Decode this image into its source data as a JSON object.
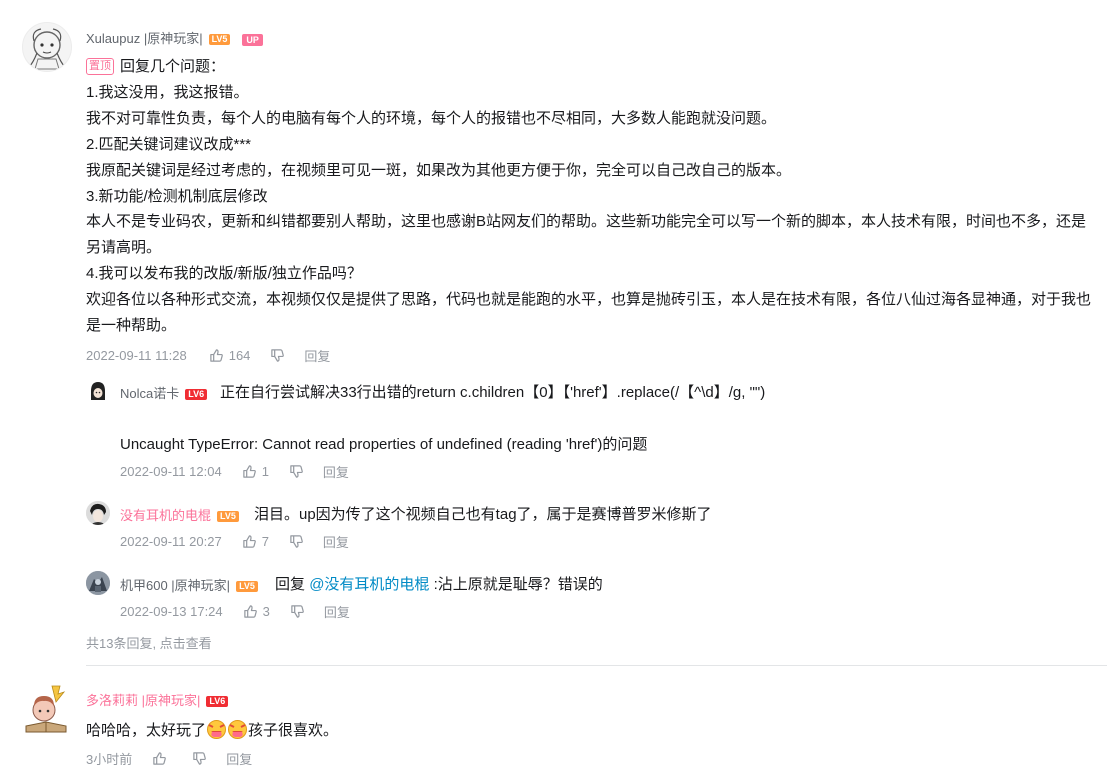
{
  "comment1": {
    "username": "Xulaupuz |原神玩家|",
    "level": "LV5",
    "up_badge": "UP",
    "pinned_label": "置顶",
    "lines": [
      "回复几个问题：",
      "1.我这没用，我这报错。",
      "我不对可靠性负责，每个人的电脑有每个人的环境，每个人的报错也不尽相同，大多数人能跑就没问题。",
      "2.匹配关键词建议改成***",
      "我原配关键词是经过考虑的，在视频里可见一斑，如果改为其他更方便于你，完全可以自己改自己的版本。",
      "3.新功能/检测机制底层修改",
      "本人不是专业码农，更新和纠错都要别人帮助，这里也感谢B站网友们的帮助。这些新功能完全可以写一个新的脚本，本人技术有限，时间也不多，还是另请高明。",
      "4.我可以发布我的改版/新版/独立作品吗？",
      "欢迎各位以各种形式交流，本视频仅仅是提供了思路，代码也就是能跑的水平，也算是抛砖引玉，本人是在技术有限，各位八仙过海各显神通，对于我也是一种帮助。"
    ],
    "time": "2022-09-11 11:28",
    "likes": "164",
    "reply_label": "回复"
  },
  "replies": [
    {
      "username": "Nolca诺卡",
      "level": "LV6",
      "line1": "正在自行尝试解决33行出错的return c.children【0】【'href'】.replace(/【^\\d】/g, \"\")",
      "line2": "Uncaught TypeError: Cannot read properties of undefined (reading 'href')的问题",
      "time": "2022-09-11 12:04",
      "likes": "1",
      "reply_label": "回复"
    },
    {
      "username": "没有耳机的电棍",
      "level": "LV5",
      "text": "泪目。up因为传了这个视频自己也有tag了，属于是赛博普罗米修斯了",
      "time": "2022-09-11 20:27",
      "likes": "7",
      "reply_label": "回复"
    },
    {
      "username": "机甲600 |原神玩家|",
      "level": "LV5",
      "reply_prefix": "回复",
      "mention": "@没有耳机的电棍",
      "text": ":沾上原就是耻辱？错误的",
      "time": "2022-09-13 17:24",
      "likes": "3",
      "reply_label": "回复"
    }
  ],
  "more_replies": "共13条回复, 点击查看",
  "comment2": {
    "username": "多洛莉莉 |原神玩家|",
    "level": "LV6",
    "text_before": "哈哈哈，太好玩了",
    "text_after": "孩子很喜欢。",
    "time": "3小时前",
    "reply_label": "回复"
  },
  "colors": {
    "pink": "#fb7299",
    "mention_blue": "#008ac5",
    "meta_gray": "#9499a0",
    "lv5": "#ff9a3c",
    "lv6": "#f02d33"
  },
  "icons": [
    "thumb-up-icon",
    "thumb-down-icon",
    "reaction-emoji-icon"
  ]
}
